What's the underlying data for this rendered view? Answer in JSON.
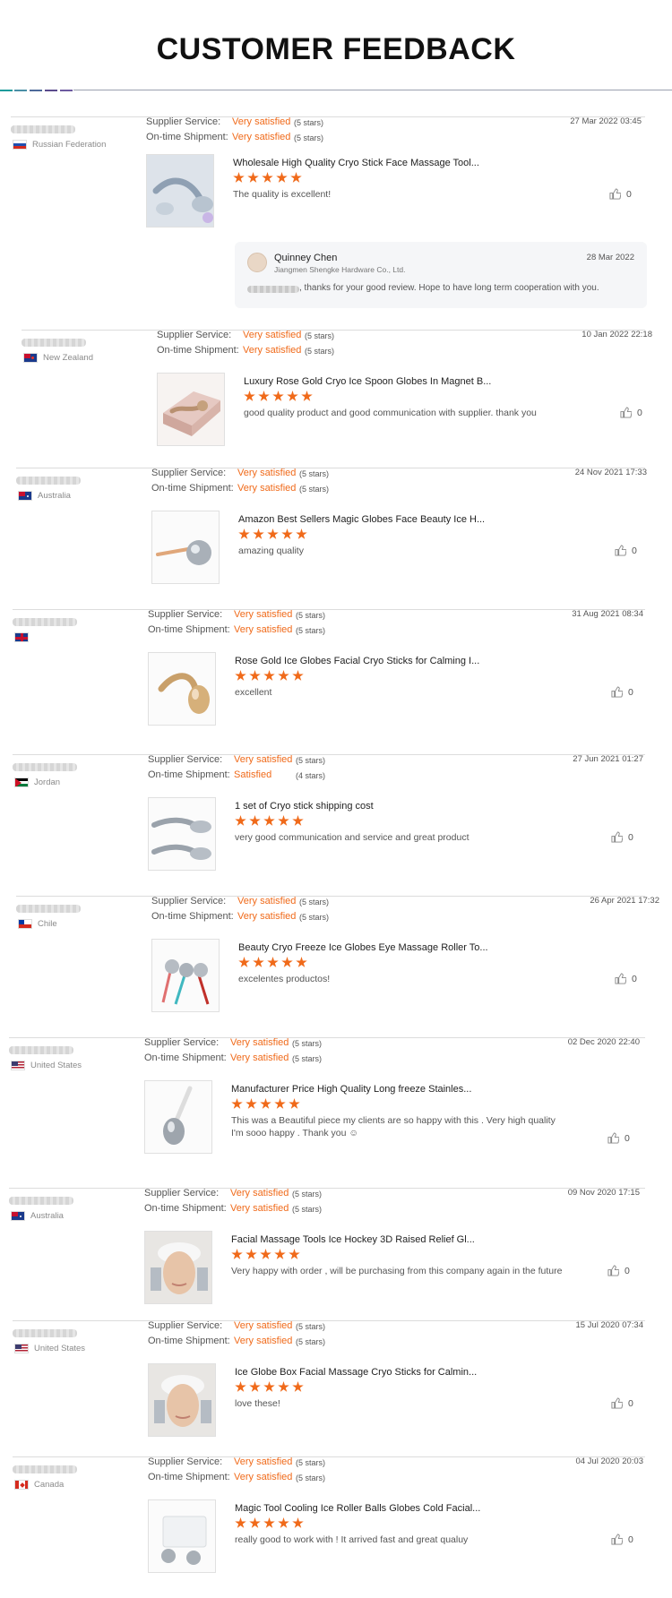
{
  "page_title": "CUSTOMER FEEDBACK",
  "accent_colors": [
    "#1a9b9b",
    "#4a8fa6",
    "#4d6a9a",
    "#5b4b8c",
    "#6d5ba0"
  ],
  "labels": {
    "supplier_service": "Supplier Service:",
    "shipment": "On-time Shipment:"
  },
  "reviews": [
    {
      "country": "Russian Federation",
      "flag": "ru",
      "service": "Very satisfied",
      "service_stars": "(5 stars)",
      "shipment": "Very satisfied",
      "shipment_stars": "(5 stars)",
      "date": "27 Mar 2022 03:45",
      "product": "Wholesale High Quality Cryo Stick Face Massage Tool...",
      "rating": 5,
      "comment": "The quality is excellent!",
      "likes": "0",
      "thumb": "cryo-stick-silver-icon"
    },
    {
      "country": "New Zealand",
      "flag": "nz",
      "service": "Very satisfied",
      "service_stars": "(5 stars)",
      "shipment": "Very satisfied",
      "shipment_stars": "(5 stars)",
      "date": "10 Jan 2022 22:18",
      "product": "Luxury Rose Gold Cryo Ice Spoon Globes In Magnet B...",
      "rating": 5,
      "comment": "good quality product and good communication with supplier. thank you",
      "likes": "0",
      "thumb": "gift-box-icon"
    },
    {
      "country": "Australia",
      "flag": "au",
      "service": "Very satisfied",
      "service_stars": "(5 stars)",
      "shipment": "Very satisfied",
      "shipment_stars": "(5 stars)",
      "date": "24 Nov 2021 17:33",
      "product": "Amazon Best Sellers Magic Globes Face Beauty Ice H...",
      "rating": 5,
      "comment": "amazing quality",
      "likes": "0",
      "thumb": "ice-globe-icon"
    },
    {
      "country": "",
      "flag": "gb",
      "service": "Very satisfied",
      "service_stars": "(5 stars)",
      "shipment": "Very satisfied",
      "shipment_stars": "(5 stars)",
      "date": "31 Aug 2021 08:34",
      "product": "Rose Gold Ice Globes Facial Cryo Sticks for Calming I...",
      "rating": 5,
      "comment": "excellent",
      "likes": "0",
      "thumb": "cryo-stick-gold-icon"
    },
    {
      "country": "Jordan",
      "flag": "jo",
      "service": "Very satisfied",
      "service_stars": "(5 stars)",
      "shipment": "Satisfied",
      "shipment_stars": "(4 stars)",
      "date": "27 Jun 2021 01:27",
      "product": "1 set of Cryo stick shipping cost",
      "rating": 5,
      "comment": "very good communication and service and great product",
      "likes": "0",
      "thumb": "cryo-stick-pair-icon"
    },
    {
      "country": "Chile",
      "flag": "cl",
      "service": "Very satisfied",
      "service_stars": "(5 stars)",
      "shipment": "Very satisfied",
      "shipment_stars": "(5 stars)",
      "date": "26 Apr 2021 17:32",
      "product": "Beauty Cryo Freeze Ice Globes Eye Massage Roller To...",
      "rating": 5,
      "comment": "excelentes productos!",
      "likes": "0",
      "thumb": "eye-roller-icon"
    },
    {
      "country": "United States",
      "flag": "us",
      "service": "Very satisfied",
      "service_stars": "(5 stars)",
      "shipment": "Very satisfied",
      "shipment_stars": "(5 stars)",
      "date": "02 Dec 2020 22:40",
      "product": "Manufacturer Price High Quality Long freeze Stainles...",
      "rating": 5,
      "comment": "This was a Beautiful piece my clients are so happy with this .  Very  high quality I'm sooo happy . Thank you ☺",
      "likes": "0",
      "thumb": "ice-spoon-icon"
    },
    {
      "country": "Australia",
      "flag": "au",
      "service": "Very satisfied",
      "service_stars": "(5 stars)",
      "shipment": "Very satisfied",
      "shipment_stars": "(5 stars)",
      "date": "09 Nov 2020 17:15",
      "product": "Facial Massage Tools Ice Hockey 3D Raised Relief Gl...",
      "rating": 5,
      "comment": "Very happy with order , will be purchasing from this company again in the future",
      "likes": "0",
      "thumb": "face-photo-icon"
    },
    {
      "country": "United States",
      "flag": "us",
      "service": "Very satisfied",
      "service_stars": "(5 stars)",
      "shipment": "Very satisfied",
      "shipment_stars": "(5 stars)",
      "date": "15 Jul 2020 07:34",
      "product": "Ice Globe Box Facial Massage Cryo Sticks for Calmin...",
      "rating": 5,
      "comment": "love these!",
      "likes": "0",
      "thumb": "face-photo-icon"
    },
    {
      "country": "Canada",
      "flag": "ca",
      "service": "Very satisfied",
      "service_stars": "(5 stars)",
      "shipment": "Very satisfied",
      "shipment_stars": "(5 stars)",
      "date": "04 Jul 2020 20:03",
      "product": "Magic Tool Cooling Ice Roller Balls Globes Cold Facial...",
      "rating": 5,
      "comment": "really good to work with ! It arrived fast and great qualuy",
      "likes": "0",
      "thumb": "roller-balls-icon"
    }
  ],
  "reply": {
    "name": "Quinney Chen",
    "company": "Jiangmen Shengke Hardware Co., Ltd.",
    "date": "28 Mar 2022",
    "text": ", thanks for your good review. Hope to have long term cooperation with you."
  }
}
